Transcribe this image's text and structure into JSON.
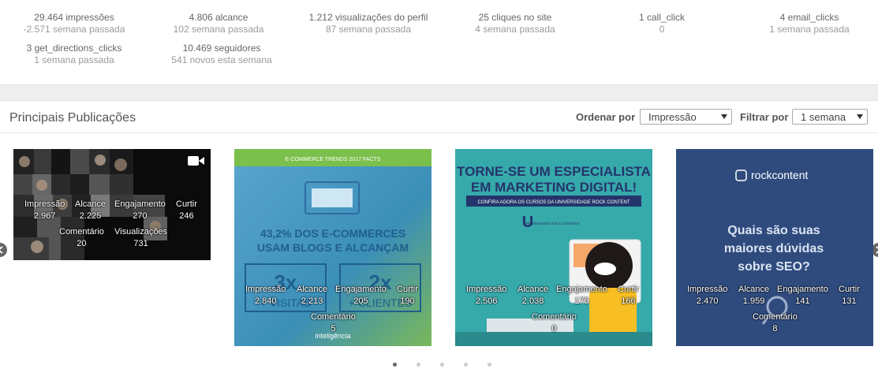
{
  "stats": [
    {
      "value": "29.464 impressões",
      "sub": "-2.571 semana passada"
    },
    {
      "value": "4.806 alcance",
      "sub": "102 semana passada"
    },
    {
      "value": "1.212 visualizações do perfil",
      "sub": "87 semana passada"
    },
    {
      "value": "25 cliques no site",
      "sub": "4 semana passada"
    },
    {
      "value": "1 call_click",
      "sub": "0"
    },
    {
      "value": "4 email_clicks",
      "sub": "1 semana passada"
    },
    {
      "value": "3 get_directions_clicks",
      "sub": "1 semana passada"
    },
    {
      "value": "10.469 seguidores",
      "sub": "541 novos esta semana"
    }
  ],
  "section": {
    "title": "Principais Publicações"
  },
  "controls": {
    "order_label": "Ordenar por",
    "order_value": "Impressão",
    "filter_label": "Filtrar por",
    "filter_value": "1 semana"
  },
  "posts": [
    {
      "icon": "video-camera-icon",
      "image_text": "",
      "metrics": [
        {
          "label": "Impressão",
          "value": "2.967"
        },
        {
          "label": "Alcance",
          "value": "2.225"
        },
        {
          "label": "Engajamento",
          "value": "270"
        },
        {
          "label": "Curtir",
          "value": "246"
        },
        {
          "label": "Comentário",
          "value": "20"
        },
        {
          "label": "Visualizações",
          "value": "731"
        }
      ]
    },
    {
      "image_text": {
        "header": "E-COMMERCE TRENDS 2017 FACTS",
        "headline1": "43,2% DOS E-COMMERCES",
        "headline2": "USAM BLOGS E ALCANÇAM",
        "stat1": "3x",
        "stat1_text": "+ VISITAS",
        "stat2": "2x",
        "stat2_text": "+ CLIENTES",
        "brand": "inteligência"
      },
      "metrics": [
        {
          "label": "Impressão",
          "value": "2.840"
        },
        {
          "label": "Alcance",
          "value": "2.213"
        },
        {
          "label": "Engajamento",
          "value": "205"
        },
        {
          "label": "Curtir",
          "value": "190"
        },
        {
          "label": "Comentário",
          "value": "5"
        }
      ]
    },
    {
      "image_text": {
        "line1": "TORNE-SE UM ESPECIALISTA",
        "line2": "EM MARKETING DIGITAL!",
        "ribbon": "CONFIRA AGORA OS CURSOS DA UNIVERSIDADE ROCK CONTENT",
        "logo": "UNIVERSIDADE ROCK CONTENT"
      },
      "metrics": [
        {
          "label": "Impressão",
          "value": "2.506"
        },
        {
          "label": "Alcance",
          "value": "2.038"
        },
        {
          "label": "Engajamento",
          "value": "175"
        },
        {
          "label": "Curtir",
          "value": "166"
        },
        {
          "label": "Comentário",
          "value": "0"
        }
      ]
    },
    {
      "image_text": {
        "brand": "rockcontent",
        "q1": "Quais são suas",
        "q2": "maiores dúvidas",
        "q3": "sobre SEO?"
      },
      "metrics": [
        {
          "label": "Impressão",
          "value": "2.470"
        },
        {
          "label": "Alcance",
          "value": "1.959"
        },
        {
          "label": "Engajamento",
          "value": "141"
        },
        {
          "label": "Curtir",
          "value": "131"
        },
        {
          "label": "Comentário",
          "value": "8"
        }
      ]
    }
  ],
  "pagination": {
    "count": 5,
    "active": 1
  }
}
